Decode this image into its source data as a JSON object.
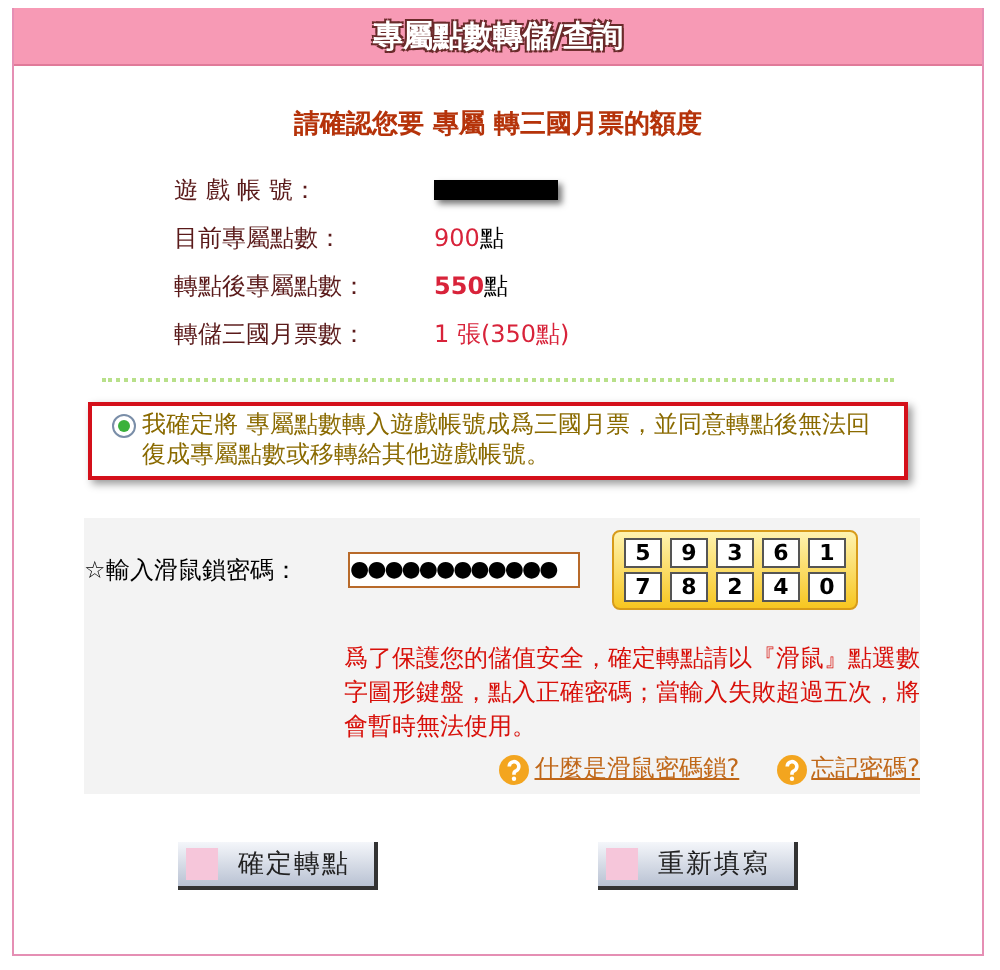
{
  "header": {
    "title": "專屬點數轉儲/查詢"
  },
  "heading": "請確認您要 專屬 轉三國月票的額度",
  "info_rows": [
    {
      "label": "遊 戲 帳 號：",
      "kind": "redacted"
    },
    {
      "label": "目前專屬點數：",
      "kind": "points",
      "value": "900",
      "unit": "點",
      "emphasis": false
    },
    {
      "label": "轉點後專屬點數：",
      "kind": "points",
      "value": "550",
      "unit": "點",
      "emphasis": true
    },
    {
      "label": "轉儲三國月票數：",
      "kind": "points",
      "value": "1 張(350點)",
      "emphasis": false
    }
  ],
  "agreement": {
    "selected": true,
    "text": "我確定將 專屬點數轉入遊戲帳號成爲三國月票，並同意轉點後無法回復成專屬點數或移轉給其他遊戲帳號。"
  },
  "password": {
    "label": "☆輸入滑鼠鎖密碼：",
    "value": "●●●●●●●●●●●●",
    "keypad": [
      [
        "5",
        "9",
        "3",
        "6",
        "1"
      ],
      [
        "7",
        "8",
        "2",
        "4",
        "0"
      ]
    ]
  },
  "notice": "爲了保護您的儲值安全，確定轉點請以『滑鼠』點選數字圖形鍵盤，點入正確密碼；當輸入失敗超過五次，將會暫時無法使用。",
  "help_links": [
    "什麼是滑鼠密碼鎖?",
    "忘記密碼?"
  ],
  "buttons": [
    "確定轉點",
    "重新填寫"
  ]
}
